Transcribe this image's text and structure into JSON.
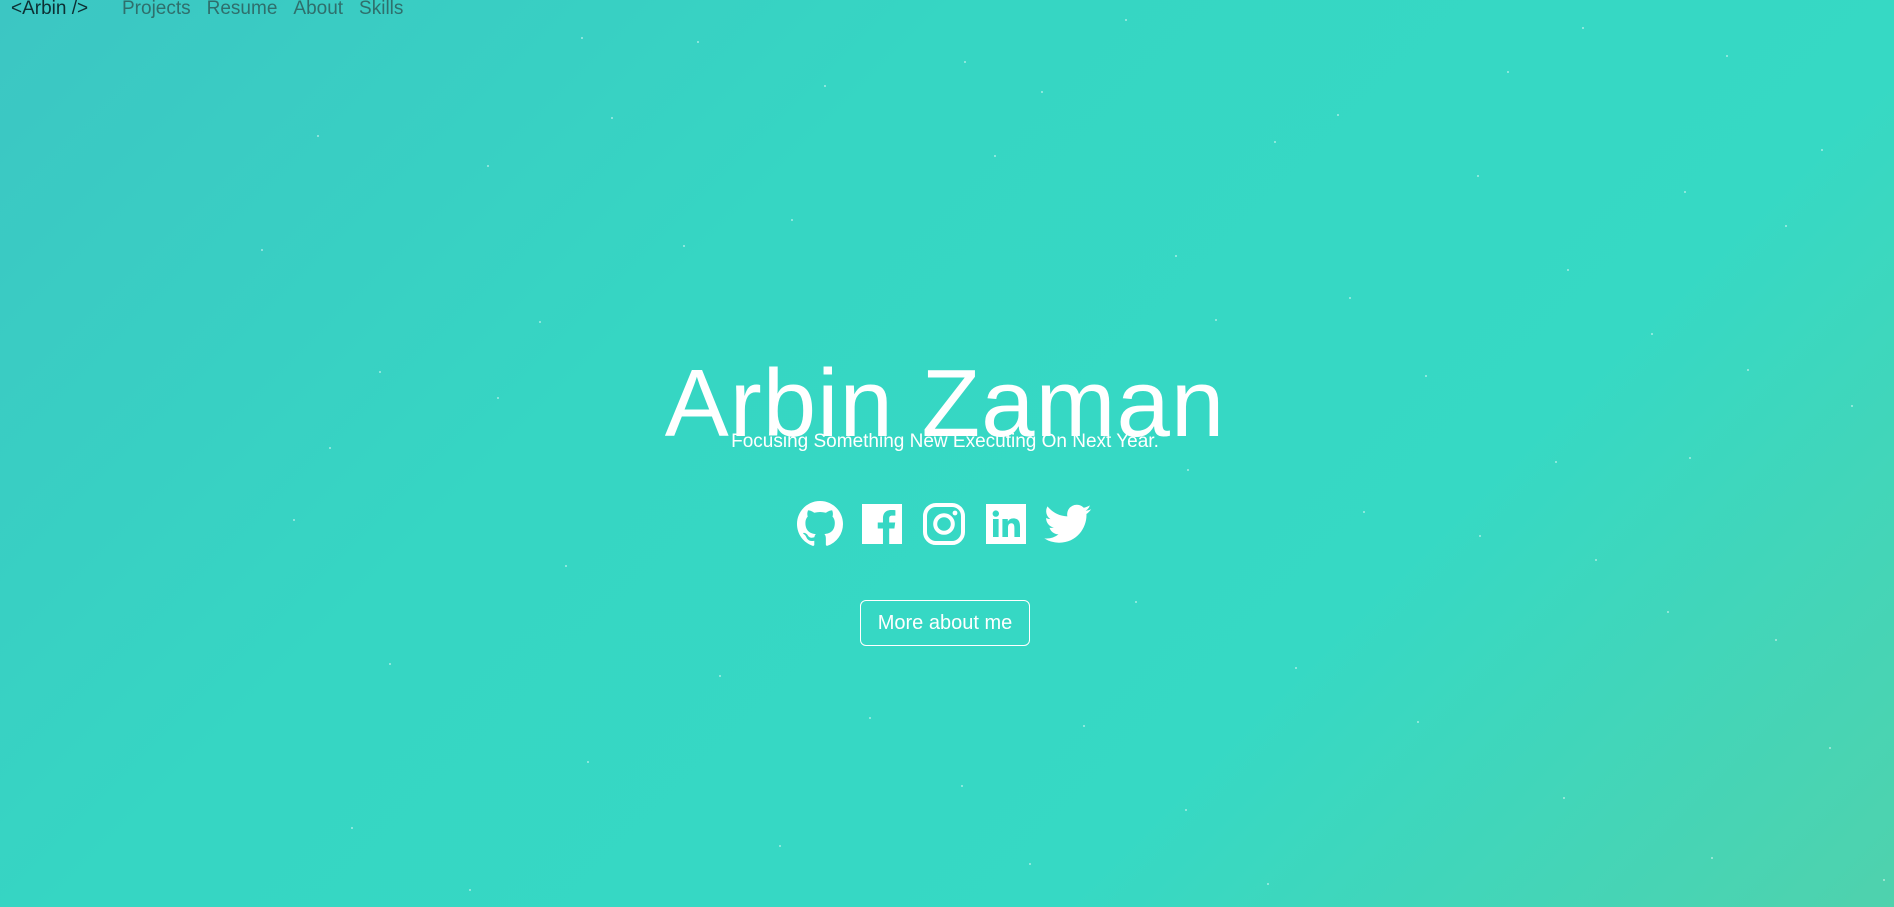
{
  "nav": {
    "brand": "<Arbin />",
    "links": [
      "Projects",
      "Resume",
      "About",
      "Skills"
    ]
  },
  "hero": {
    "title": "Arbin Zaman",
    "subtitle": "Focusing Something New Executing On Next Year.",
    "button_label": "More about me"
  },
  "social": {
    "icons": [
      "github-icon",
      "facebook-icon",
      "instagram-icon",
      "linkedin-icon",
      "twitter-icon"
    ]
  },
  "colors": {
    "background_start": "#3cc6c3",
    "background_mid": "#36d9c4",
    "background_end": "#4fd2ad",
    "text": "#ffffff",
    "brand_text": "#0d2f33",
    "nav_link": "#2f6f6c"
  }
}
